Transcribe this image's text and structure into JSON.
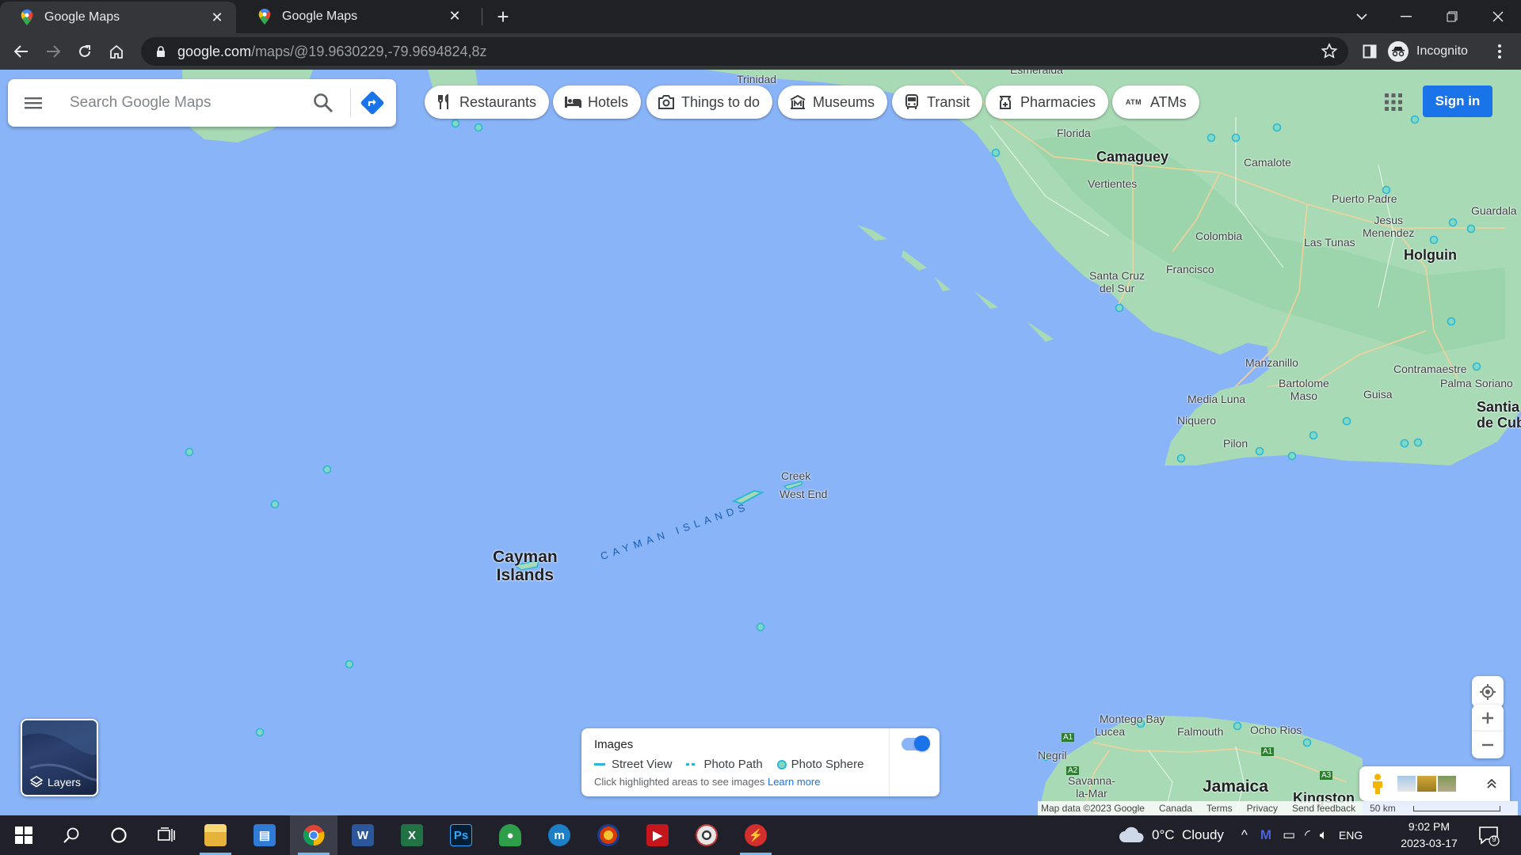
{
  "browser": {
    "tabs": [
      {
        "title": "Google Maps",
        "active": true
      },
      {
        "title": "Google Maps",
        "active": false
      }
    ],
    "url_host": "google.com",
    "url_path": "/maps/@19.9630229,-79.9694824,8z",
    "profile_label": "Incognito"
  },
  "maps": {
    "search_placeholder": "Search Google Maps",
    "chips": [
      {
        "label": "Restaurants",
        "icon": "fork-knife-icon"
      },
      {
        "label": "Hotels",
        "icon": "bed-icon"
      },
      {
        "label": "Things to do",
        "icon": "camera-icon"
      },
      {
        "label": "Museums",
        "icon": "museum-icon"
      },
      {
        "label": "Transit",
        "icon": "bus-icon"
      },
      {
        "label": "Pharmacies",
        "icon": "pharmacy-icon"
      },
      {
        "label": "ATMs",
        "icon": "atm-icon"
      }
    ],
    "sign_in": "Sign in",
    "layers_label": "Layers",
    "places": {
      "esmeralda": "Esmeralda",
      "trinidad": "Trinidad",
      "florida": "Florida",
      "camaguey": "Camaguey",
      "camalote": "Camalote",
      "vertientes": "Vertientes",
      "puerto_padre": "Puerto Padre",
      "guardalavaca": "Guardala",
      "jesus_menendez": "Jesus\nMenendez",
      "colombia": "Colombia",
      "las_tunas": "Las Tunas",
      "holguin": "Holguin",
      "francisco": "Francisco",
      "santa_cruz": "Santa Cruz\ndel Sur",
      "manzanillo": "Manzanillo",
      "contramaestre": "Contramaestre",
      "bartolome_maso": "Bartolome\nMaso",
      "palma_soriano": "Palma Soriano",
      "media_luna": "Media Luna",
      "guisa": "Guisa",
      "santiago": "Santia\nde Cub",
      "niquero": "Niquero",
      "pilon": "Pilon",
      "creek": "Creek",
      "west_end": "West End",
      "cayman_sea": "CAYMAN ISLANDS",
      "cayman_country": "Cayman\nIslands",
      "montego_bay": "Montego Bay",
      "lucea": "Lucea",
      "falmouth": "Falmouth",
      "ocho_rios": "Ocho Rios",
      "negril": "Negril",
      "savanna": "Savanna-\nla-Mar",
      "jamaica": "Jamaica",
      "kingston": "Kingston",
      "a1": "A1",
      "a2": "A2",
      "a3": "A3"
    },
    "images_panel": {
      "title": "Images",
      "street_view": "Street View",
      "photo_path": "Photo Path",
      "photo_sphere": "Photo Sphere",
      "hint": "Click highlighted areas to see images",
      "learn_more": "Learn more",
      "toggle_on": true
    },
    "attribution": {
      "map_data": "Map data ©2023 Google",
      "region": "Canada",
      "terms": "Terms",
      "privacy": "Privacy",
      "feedback": "Send feedback",
      "scale": "50 km"
    }
  },
  "taskbar": {
    "weather": "0°C  Cloudy",
    "language": "ENG",
    "time": "9:02 PM",
    "date": "2023-03-17",
    "notifications": "9"
  },
  "colors": {
    "water": "#8ab4f8",
    "land": "#a8dab5",
    "land_dark": "#94d2a5",
    "accent": "#1a73e8",
    "chrome_dark": "#202124"
  }
}
